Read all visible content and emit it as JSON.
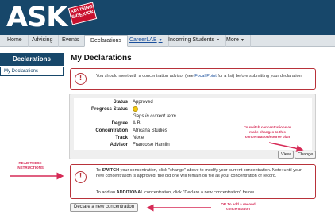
{
  "header": {
    "logo_text": "ASK",
    "logo_stamp_lines": [
      "ADVISING",
      "SIDEKICK"
    ]
  },
  "nav": {
    "items": [
      {
        "label": "Home"
      },
      {
        "label": "Advising"
      },
      {
        "label": "Events"
      },
      {
        "label": "Declarations"
      },
      {
        "label": "CareerLAB"
      },
      {
        "label": "Incoming Students"
      },
      {
        "label": "More"
      }
    ],
    "active": "Declarations"
  },
  "sidebar": {
    "heading": "Declarations",
    "items": [
      {
        "label": "My Declarations"
      }
    ]
  },
  "main": {
    "title": "My Declarations",
    "alert1": {
      "before": "You should meet with a concentration advisor (see ",
      "link": "Focal Point",
      "after": " for a list) before submitting your declaration."
    },
    "details": {
      "status_label": "Status",
      "status_value": "Approved",
      "progress_label": "Progress Status",
      "progress_note": "Gaps in current term.",
      "degree_label": "Degree",
      "degree_value": "A.B.",
      "concentration_label": "Concentration",
      "concentration_value": "Africana Studies",
      "track_label": "Track",
      "track_value": "None",
      "advisor_label": "Advisor",
      "advisor_value": "Francoise Hamlin",
      "view_button": "View",
      "change_button": "Change"
    },
    "alert2": {
      "switch_prefix": "To ",
      "switch_bold": "SWITCH",
      "switch_rest": " your concentration, click \"change\" above to modify your current concentration. Note: until your new concentration is approved, the old one will remain on file as your concentration of record.",
      "add_prefix": "To add an ",
      "add_bold": "ADDITIONAL",
      "add_rest": " concentration, click \"Declare a new concentration\" below."
    },
    "declare_button": "Declare a new concentration"
  },
  "annotations": {
    "switch_note": "To switch concentrations or make changes to this concentration/course plan",
    "read_note": "READ THESE INSTRUCTIONS",
    "second_note": "OR To add a second concentration",
    "color": "#d62a56"
  },
  "colors": {
    "header_bg": "#17476a",
    "alert_border": "#b8323a",
    "status_dot": "#f2c811"
  }
}
